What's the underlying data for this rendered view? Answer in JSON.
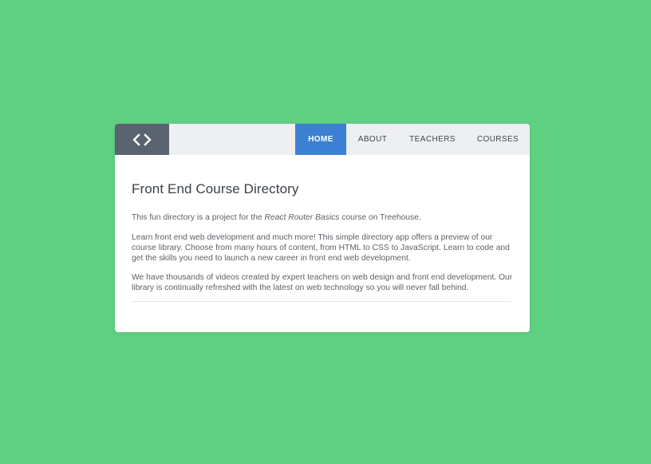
{
  "header": {
    "logo_icon": "code-brackets-icon",
    "nav": [
      {
        "label": "HOME",
        "active": true
      },
      {
        "label": "ABOUT",
        "active": false
      },
      {
        "label": "TEACHERS",
        "active": false
      },
      {
        "label": "COURSES",
        "active": false
      }
    ]
  },
  "main": {
    "title": "Front End Course Directory",
    "intro": {
      "before": "This fun directory is a project for the ",
      "emphasis": "React Router Basics",
      "after": " course on Treehouse."
    },
    "paragraph_2": "Learn front end web development and much more! This simple directory app offers a preview of our course library. Choose from many hours of content, from HTML to CSS to JavaScript. Learn to code and get the skills you need to launch a new career in front end web development.",
    "paragraph_3": "We have thousands of videos created by expert teachers on web design and front end development. Our library is continually refreshed with the latest on web technology so you will never fall behind."
  },
  "colors": {
    "background": "#5fd081",
    "logo_bg": "#5a6470",
    "nav_bg": "#eeeff1",
    "active_tab": "#3b80d3"
  }
}
